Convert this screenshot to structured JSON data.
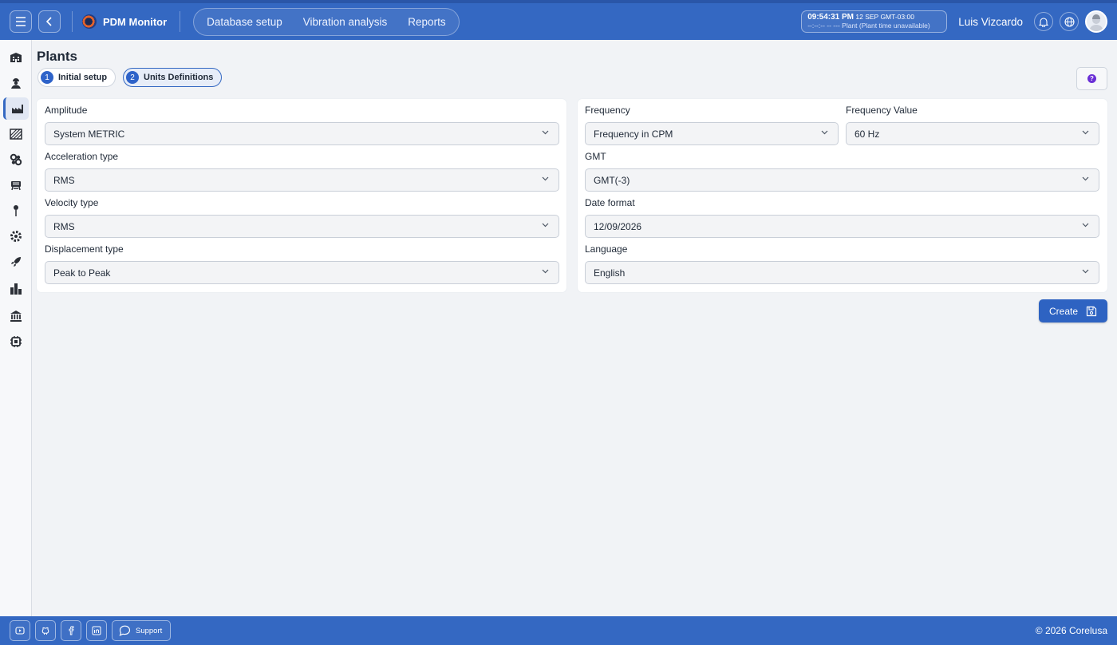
{
  "app": {
    "name": "PDM Monitor"
  },
  "nav": [
    {
      "label": "Database setup"
    },
    {
      "label": "Vibration analysis"
    },
    {
      "label": "Reports"
    }
  ],
  "clock": {
    "time": "09:54:31 PM",
    "date": "12 SEP",
    "tz": "GMT-03:00",
    "plant_time": "--:--:-- -- ---",
    "plant_note": "Plant (Plant time unavailable)"
  },
  "user": {
    "name": "Luis Vizcardo"
  },
  "page": {
    "title": "Plants"
  },
  "steps": [
    {
      "num": "1",
      "label": "Initial setup"
    },
    {
      "num": "2",
      "label": "Units Definitions"
    }
  ],
  "help_icon": "?",
  "left_panel": {
    "amplitude": {
      "label": "Amplitude",
      "value": "System METRIC"
    },
    "acceleration": {
      "label": "Acceleration type",
      "value": "RMS"
    },
    "velocity": {
      "label": "Velocity type",
      "value": "RMS"
    },
    "displacement": {
      "label": "Displacement type",
      "value": "Peak to Peak"
    }
  },
  "right_panel": {
    "frequency": {
      "label": "Frequency",
      "value": "Frequency in CPM"
    },
    "frequency_value": {
      "label": "Frequency Value",
      "value": "60 Hz"
    },
    "gmt": {
      "label": "GMT",
      "value": "GMT(-3)"
    },
    "date_format": {
      "label": "Date format",
      "value": "12/09/2026"
    },
    "language": {
      "label": "Language",
      "value": "English"
    }
  },
  "actions": {
    "create": "Create"
  },
  "footer": {
    "support": "Support",
    "copyright": "© 2026 Corelusa"
  },
  "colors": {
    "primary": "#3468c2",
    "accent": "#2e63c9",
    "help": "#6a2fd6"
  },
  "sidebar_icons": [
    "building-icon",
    "worker-icon",
    "factory-icon",
    "area-icon",
    "gears-icon",
    "machine-icon",
    "sensor-pin-icon",
    "settings-gear-icon",
    "rocket-icon",
    "bar-chart-icon",
    "bank-icon",
    "chip-icon"
  ]
}
